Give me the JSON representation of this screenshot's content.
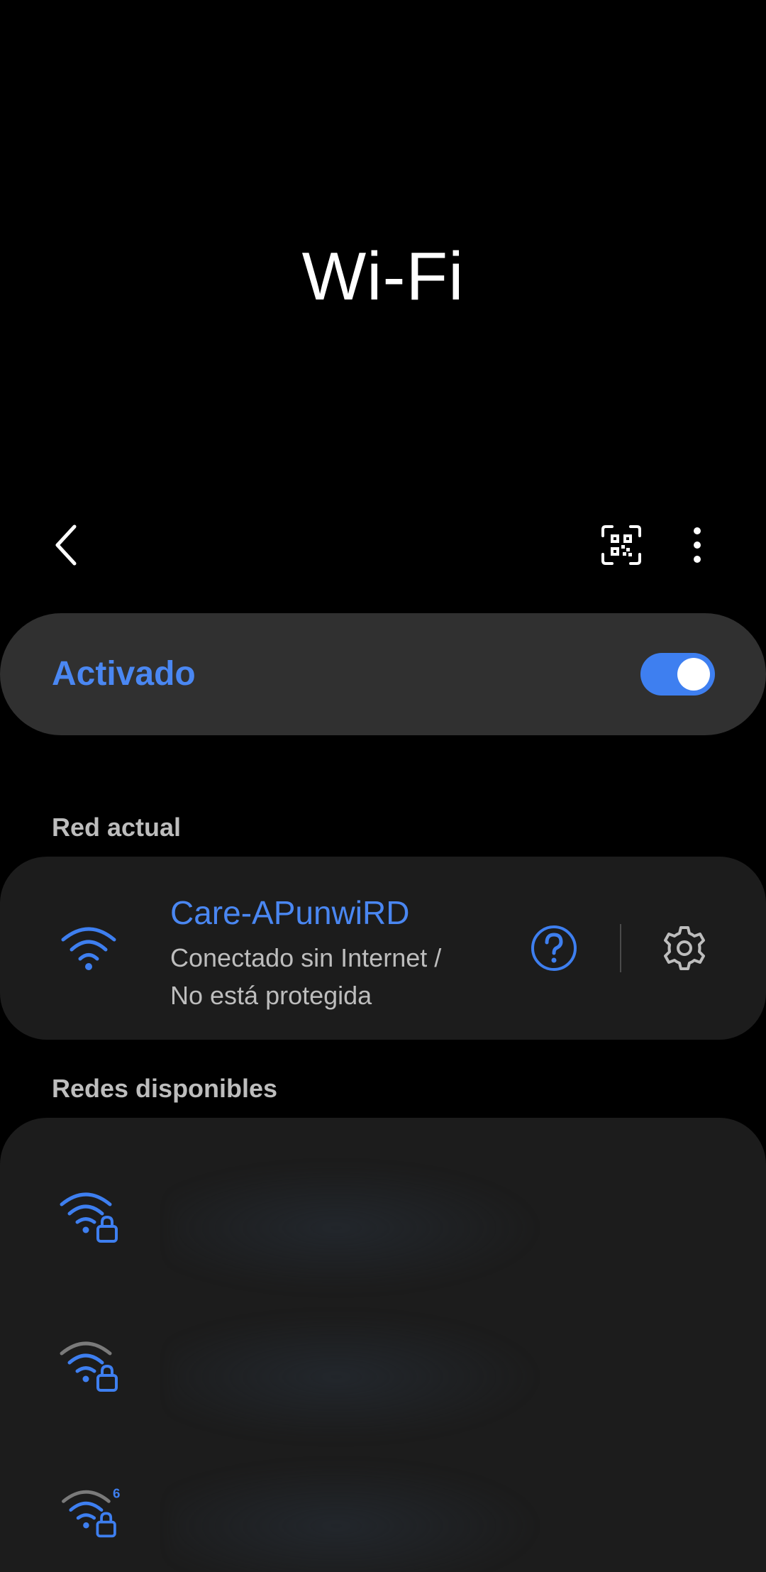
{
  "page": {
    "title": "Wi-Fi"
  },
  "toolbar": {
    "back_icon": "chevron-left-icon",
    "qr_icon": "qr-scan-icon",
    "more_icon": "more-vertical-icon"
  },
  "wifi_switch": {
    "label": "Activado",
    "state": "on",
    "accent_color": "#3e7ff0"
  },
  "current_network": {
    "header": "Red actual",
    "name": "Care-APunwiRD",
    "status_line1": "Conectado sin Internet /",
    "status_line2": "No está protegida",
    "help_icon": "help-circle-icon",
    "settings_icon": "gear-icon"
  },
  "available_networks": {
    "header": "Redes disponibles",
    "items": [
      {
        "icon": "wifi-locked-icon",
        "signal_color": "#3e7ff0",
        "badge": ""
      },
      {
        "icon": "wifi-locked-icon",
        "signal_color": "#7a7a7a",
        "badge": ""
      },
      {
        "icon": "wifi-6-locked-icon",
        "signal_color": "#7a7a7a",
        "badge": "6"
      }
    ]
  }
}
